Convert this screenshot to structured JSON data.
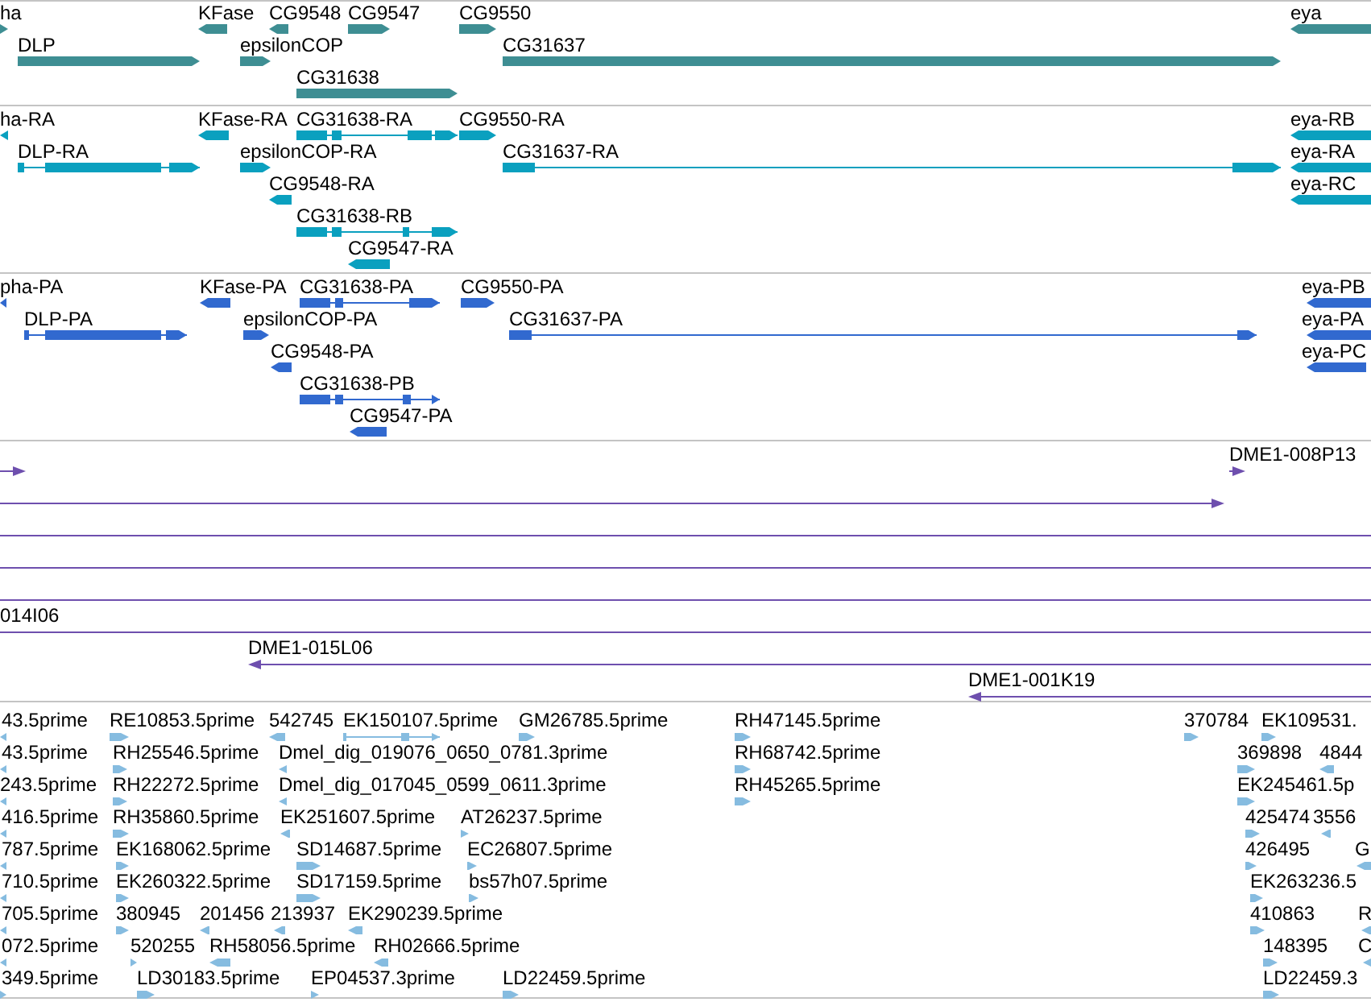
{
  "tracks": [
    {
      "kind": "genes",
      "features": [
        {
          "label": "ha",
          "reverse": false
        },
        {
          "label": "KFase",
          "reverse": true
        },
        {
          "label": "CG9548",
          "reverse": true
        },
        {
          "label": "CG9547",
          "reverse": false
        },
        {
          "label": "CG9550",
          "reverse": false
        },
        {
          "label": "eya",
          "reverse": true
        },
        {
          "label": "DLP",
          "reverse": false
        },
        {
          "label": "epsilonCOP",
          "reverse": false
        },
        {
          "label": "CG31637",
          "reverse": false
        },
        {
          "label": "CG31638",
          "reverse": false
        }
      ]
    },
    {
      "kind": "transcripts",
      "features": [
        {
          "label": "ha-RA",
          "reverse": true
        },
        {
          "label": "KFase-RA",
          "reverse": true
        },
        {
          "label": "CG31638-RA",
          "reverse": false
        },
        {
          "label": "CG9550-RA",
          "reverse": false
        },
        {
          "label": "eya-RB",
          "reverse": true
        },
        {
          "label": "DLP-RA",
          "reverse": false
        },
        {
          "label": "epsilonCOP-RA",
          "reverse": false
        },
        {
          "label": "CG31637-RA",
          "reverse": false
        },
        {
          "label": "eya-RA",
          "reverse": true
        },
        {
          "label": "CG9548-RA",
          "reverse": true
        },
        {
          "label": "eya-RC",
          "reverse": true
        },
        {
          "label": "CG31638-RB",
          "reverse": false
        },
        {
          "label": "CG9547-RA",
          "reverse": true
        }
      ]
    },
    {
      "kind": "proteins",
      "features": [
        {
          "label": "pha-PA",
          "reverse": true
        },
        {
          "label": "KFase-PA",
          "reverse": true
        },
        {
          "label": "CG31638-PA",
          "reverse": false
        },
        {
          "label": "CG9550-PA",
          "reverse": false
        },
        {
          "label": "eya-PB",
          "reverse": true
        },
        {
          "label": "DLP-PA",
          "reverse": false
        },
        {
          "label": "epsilonCOP-PA",
          "reverse": false
        },
        {
          "label": "CG31637-PA",
          "reverse": false
        },
        {
          "label": "eya-PA",
          "reverse": true
        },
        {
          "label": "CG9548-PA",
          "reverse": true
        },
        {
          "label": "eya-PC",
          "reverse": true
        },
        {
          "label": "CG31638-PB",
          "reverse": false
        },
        {
          "label": "CG9547-PA",
          "reverse": true
        }
      ]
    },
    {
      "kind": "clones",
      "features": [
        {
          "arrowhead": true,
          "reverse": false
        },
        {
          "label": "DME1-008P13",
          "arrowhead": true,
          "reverse": false
        },
        {
          "arrowhead": true,
          "reverse": false
        },
        {
          "arrowhead": false
        },
        {
          "arrowhead": false
        },
        {
          "arrowhead": false
        },
        {
          "label": "014I06",
          "arrowhead": false
        },
        {
          "label": "DME1-015L06",
          "arrowhead": true,
          "reverse": true
        },
        {
          "label": "DME1-001K19",
          "arrowhead": true,
          "reverse": true
        }
      ]
    },
    {
      "kind": "ests",
      "features": [
        {
          "label": "43.5prime",
          "reverse": true
        },
        {
          "label": "RE10853.5prime",
          "reverse": false
        },
        {
          "label": "542745",
          "reverse": true
        },
        {
          "label": "EK150107.5prime",
          "reverse": false
        },
        {
          "label": "GM26785.5prime",
          "reverse": false
        },
        {
          "label": "RH47145.5prime",
          "reverse": false
        },
        {
          "label": "370784",
          "reverse": false
        },
        {
          "label": "EK109531.",
          "reverse": false
        },
        {
          "label": "43.5prime",
          "reverse": true
        },
        {
          "label": "RH25546.5prime",
          "reverse": false
        },
        {
          "label": "Dmel_dig_019076_0650_0781.3prime",
          "reverse": true
        },
        {
          "label": "RH68742.5prime",
          "reverse": false
        },
        {
          "label": "369898",
          "reverse": false
        },
        {
          "label": "4844",
          "reverse": true
        },
        {
          "label": "243.5prime",
          "reverse": true
        },
        {
          "label": "RH22272.5prime",
          "reverse": false
        },
        {
          "label": "Dmel_dig_017045_0599_0611.3prime",
          "reverse": true
        },
        {
          "label": "RH45265.5prime",
          "reverse": false
        },
        {
          "label": "EK245461.5p",
          "reverse": false
        },
        {
          "label": "416.5prime",
          "reverse": true
        },
        {
          "label": "RH35860.5prime",
          "reverse": false
        },
        {
          "label": "EK251607.5prime",
          "reverse": true
        },
        {
          "label": "AT26237.5prime",
          "reverse": false
        },
        {
          "label": "425474",
          "reverse": false
        },
        {
          "label": "3556",
          "reverse": true
        },
        {
          "label": "787.5prime",
          "reverse": true
        },
        {
          "label": "EK168062.5prime",
          "reverse": false
        },
        {
          "label": "SD14687.5prime",
          "reverse": false
        },
        {
          "label": "EC26807.5prime",
          "reverse": false
        },
        {
          "label": "426495",
          "reverse": false
        },
        {
          "label": "G",
          "reverse": true
        },
        {
          "label": "710.5prime",
          "reverse": true
        },
        {
          "label": "EK260322.5prime",
          "reverse": false
        },
        {
          "label": "SD17159.5prime",
          "reverse": false
        },
        {
          "label": "bs57h07.5prime",
          "reverse": false
        },
        {
          "label": "EK263236.5",
          "reverse": false
        },
        {
          "label": "705.5prime",
          "reverse": true
        },
        {
          "label": "380945",
          "reverse": false
        },
        {
          "label": "201456",
          "reverse": true
        },
        {
          "label": "213937",
          "reverse": true
        },
        {
          "label": "EK290239.5prime",
          "reverse": true
        },
        {
          "label": "410863",
          "reverse": false
        },
        {
          "label": "R",
          "reverse": true
        },
        {
          "label": "072.5prime",
          "reverse": true
        },
        {
          "label": "520255",
          "reverse": false
        },
        {
          "label": "RH58056.5prime",
          "reverse": true
        },
        {
          "label": "RH02666.5prime",
          "reverse": true
        },
        {
          "label": "148395",
          "reverse": false
        },
        {
          "label": "C",
          "reverse": true
        },
        {
          "label": "349.5prime",
          "reverse": false
        },
        {
          "label": "LD30183.5prime",
          "reverse": false
        },
        {
          "label": "EP04537.3prime",
          "reverse": false
        },
        {
          "label": "LD22459.5prime",
          "reverse": false
        },
        {
          "label": "LD22459.3",
          "reverse": false
        }
      ]
    }
  ]
}
